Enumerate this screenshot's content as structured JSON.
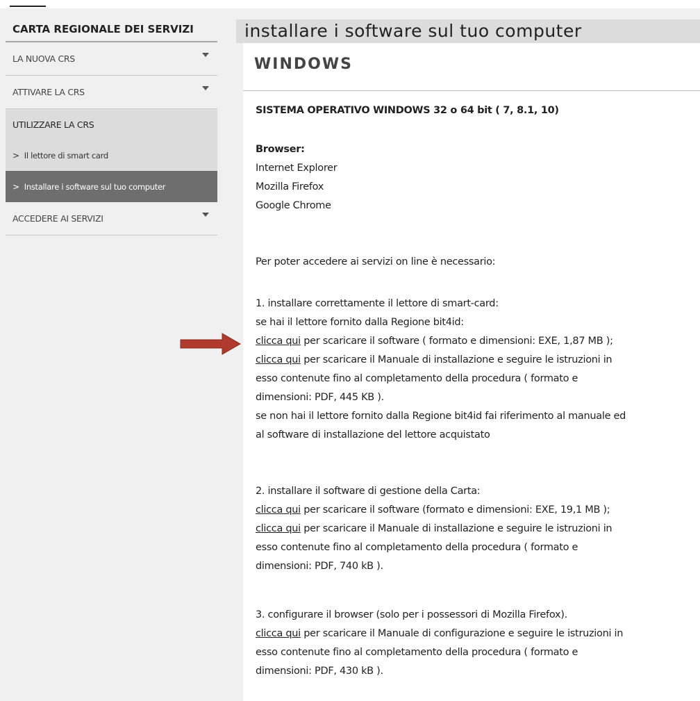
{
  "sidebar": {
    "title": "CARTA REGIONALE DEI SERVIZI",
    "items": [
      {
        "label": "LA NUOVA CRS"
      },
      {
        "label": "ATTIVARE LA CRS"
      },
      {
        "label": "UTILIZZARE LA CRS"
      },
      {
        "label": "ACCEDERE AI SERVIZI"
      }
    ],
    "subitems": [
      {
        "label": "Il lettore di smart card"
      },
      {
        "label": "Installare i software sul tuo computer"
      }
    ]
  },
  "page": {
    "title": "installare i software sul tuo computer",
    "section": "WINDOWS",
    "os_title": "SISTEMA OPERATIVO WINDOWS 32 o 64 bit ( 7, 8.1, 10)",
    "browser_label": "Browser:",
    "browsers": [
      "Internet Explorer",
      "Mozilla Firefox",
      "Google Chrome"
    ],
    "intro": "Per poter accedere ai servizi on line è necessario:",
    "link_text": "clicca qui",
    "step1": {
      "title": "1. installare correttamente il lettore di smart-card:",
      "line1": "se hai il lettore fornito dalla Regione bit4id:",
      "link1_rest": " per scaricare il software ( formato e dimensioni: EXE, 1,87 MB );",
      "link2_rest": " per scaricare il Manuale di installazione e seguire le istruzioni in",
      "line_cont": "esso contenute fino al completamento della procedura ( formato e",
      "line_dim": "dimensioni: PDF, 445 KB ).",
      "line_else1": "se non hai il lettore fornito dalla Regione bit4id fai riferimento al manuale ed",
      "line_else2": "al software di installazione del lettore acquistato"
    },
    "step2": {
      "title": "2. installare il software di gestione della Carta:",
      "link1_rest": " per scaricare il software (formato e dimensioni: EXE, 19,1 MB );",
      "link2_rest": " per scaricare il Manuale di installazione e seguire le istruzioni in",
      "line_cont": "esso contenute fino al completamento della procedura ( formato e",
      "line_dim": "dimensioni: PDF, 740 kB )."
    },
    "step3": {
      "title": "3. configurare il browser (solo per i possessori di Mozilla Firefox).",
      "link1_rest": " per scaricare il Manuale di configurazione e seguire le istruzioni in",
      "line_cont": "esso contenute fino al completamento della procedura ( formato e",
      "line_dim": "dimensioni: PDF, 430 kB )."
    }
  },
  "colors": {
    "arrow": "#b03a2e",
    "active_sub": "#6e6e6e",
    "accent_gray": "#dcdcdc"
  },
  "icons": [
    "caret-down-icon",
    "chevron-right-icon",
    "red-arrow-icon"
  ]
}
